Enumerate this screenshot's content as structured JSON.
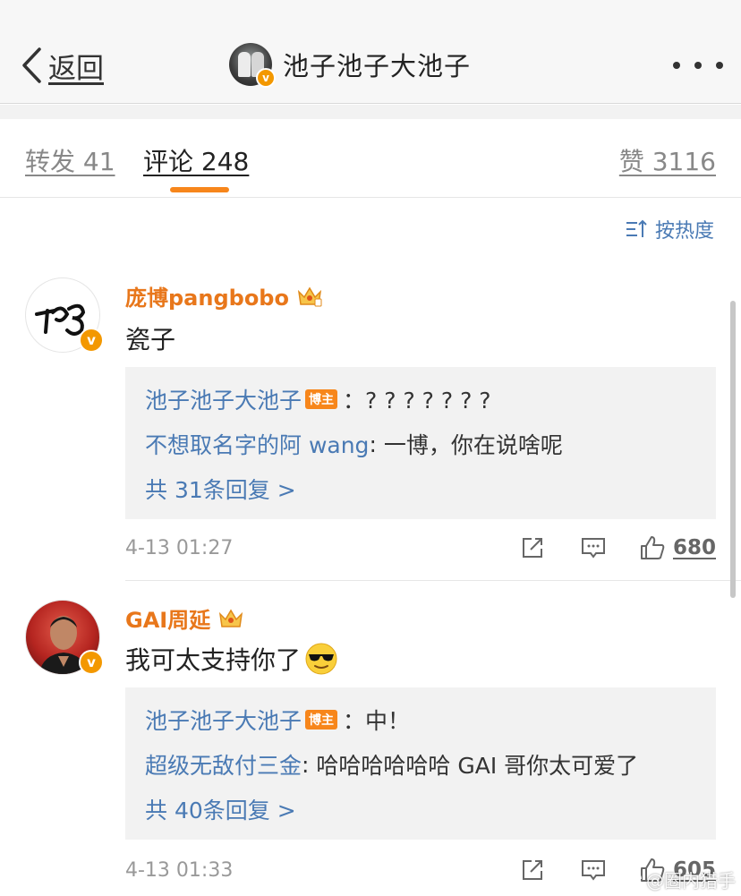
{
  "nav": {
    "back_label": "返回",
    "title": "池子池子大池子",
    "verified_badge": "v"
  },
  "tabs": [
    {
      "label": "转发 41",
      "active": false
    },
    {
      "label": "评论 248",
      "active": true
    },
    {
      "label": "赞 3116",
      "active": false
    }
  ],
  "sort": {
    "label": "按热度",
    "icon": "sort-icon"
  },
  "comments": [
    {
      "username": "庞博pangbobo",
      "badge": "crown",
      "text": "瓷子",
      "replies": [
        {
          "user": "池子池子大池子",
          "author_tag": "博主",
          "text": "：? ? ? ? ? ? ?"
        },
        {
          "user": "不想取名字的阿 wang",
          "text": "一博，你在说啥呢"
        }
      ],
      "more_replies": "共 31条回复 >",
      "time": "4-13 01:27",
      "likes": "680"
    },
    {
      "username": "GAI周延",
      "badge": "crown",
      "text": "我可太支持你了",
      "emoji": "cool-sunglasses-emoji",
      "replies": [
        {
          "user": "池子池子大池子",
          "author_tag": "博主",
          "text": "：中！"
        },
        {
          "user": "超级无敌付三金",
          "text": "哈哈哈哈哈哈 GAI 哥你太可爱了"
        }
      ],
      "more_replies": "共 40条回复 >",
      "time": "4-13 01:33",
      "likes": "605"
    }
  ],
  "watermark": "@圈内猎手",
  "colors": {
    "accent": "#f7861b",
    "link": "#4a7ab4",
    "verified": "#f39800"
  }
}
